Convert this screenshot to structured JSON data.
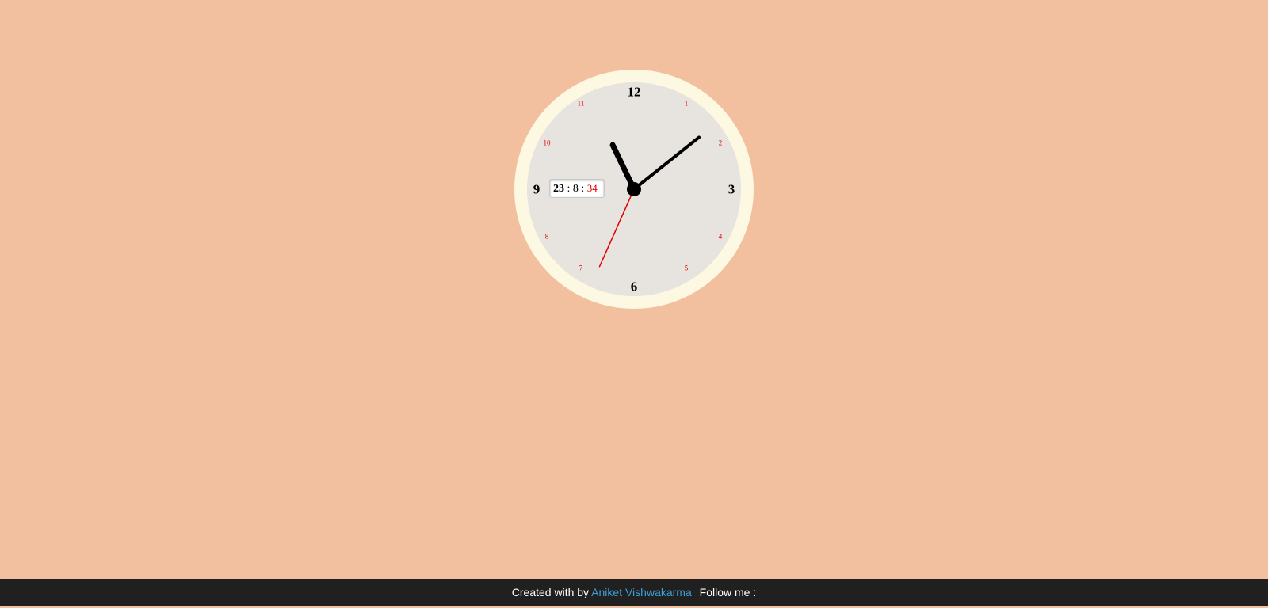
{
  "clock": {
    "hour_numerals": {
      "12": "12",
      "3": "3",
      "6": "6",
      "9": "9"
    },
    "minor_numerals": {
      "1": "1",
      "2": "2",
      "4": "4",
      "5": "5",
      "7": "7",
      "8": "8",
      "10": "10",
      "11": "11"
    },
    "digital": {
      "hours": "23",
      "separator": ":",
      "minutes": "8",
      "seconds": "34"
    },
    "time": {
      "hours": 23,
      "minutes": 8,
      "seconds": 34
    },
    "colors": {
      "background": "#f2c09e",
      "rim": "#fdf8e1",
      "face": "#e7e3de",
      "hands": "#000000",
      "second_hand": "#e00000",
      "minor_numerals": "#e00000"
    }
  },
  "footer": {
    "created_text": "Created with by",
    "author": "Aniket Vishwakarma",
    "follow_text": "Follow me :",
    "colors": {
      "background": "#202020",
      "link": "#3d9fd6"
    }
  }
}
